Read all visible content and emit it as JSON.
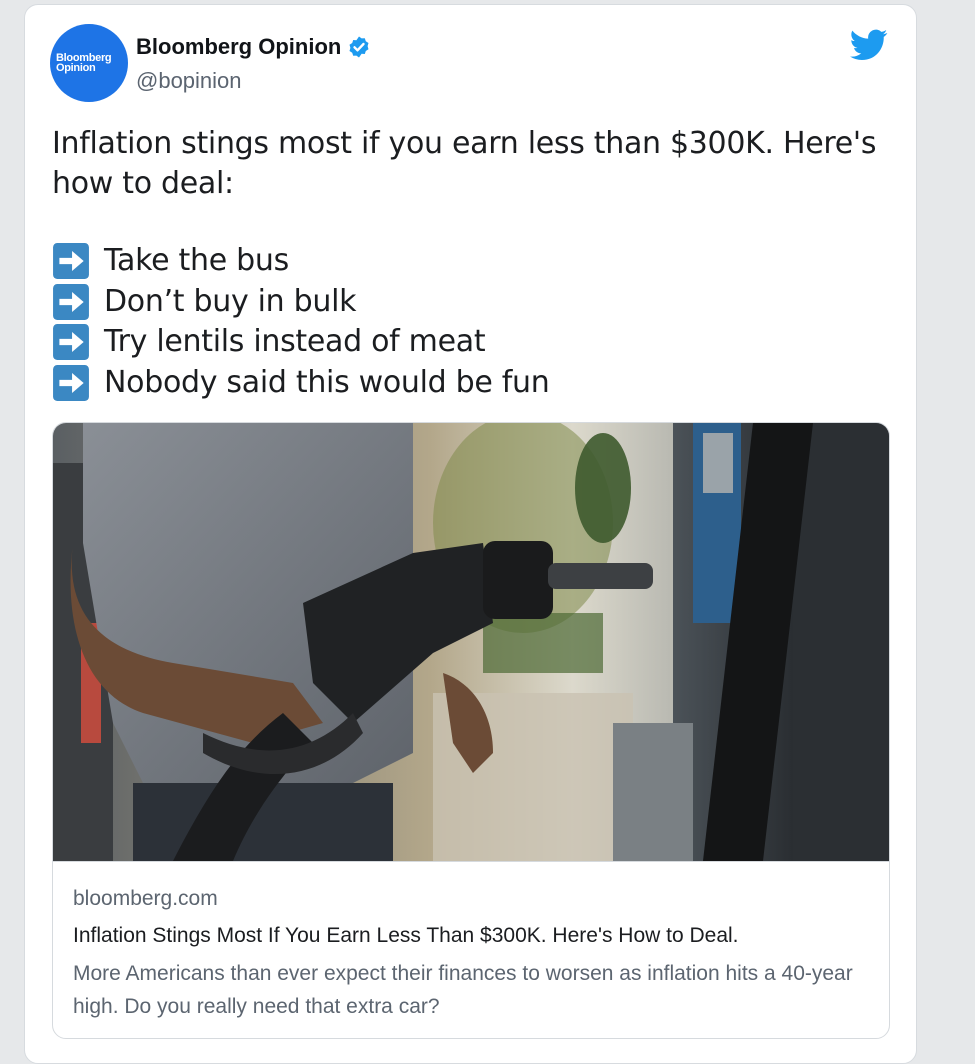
{
  "tweet": {
    "author": {
      "avatar_text_line1": "Bloomberg",
      "avatar_text_line2": "Opinion",
      "display_name": "Bloomberg Opinion",
      "handle": "@bopinion",
      "verified": true,
      "avatar_color": "#1e74e6"
    },
    "text_lines": [
      "Inflation stings most if you earn less than $300K. Here's",
      "how to deal:"
    ],
    "bullets": [
      {
        "icon": "right-arrow-emoji-icon",
        "text": "Take the bus"
      },
      {
        "icon": "right-arrow-emoji-icon",
        "text": "Don’t buy in bulk"
      },
      {
        "icon": "right-arrow-emoji-icon",
        "text": "Try lentils instead of meat"
      },
      {
        "icon": "right-arrow-emoji-icon",
        "text": "Nobody said this would be fun"
      }
    ],
    "link_card": {
      "image": "photo-gas-pump-nozzle",
      "domain": "bloomberg.com",
      "title": "Inflation Stings Most If You Earn Less Than $300K. Here's How to Deal.",
      "description": "More Americans than ever expect their finances to worsen as inflation hits a 40-year high. Do you really need that extra car?"
    }
  },
  "icons": {
    "verified": "verified-badge-icon",
    "platform": "twitter-bird-icon"
  },
  "colors": {
    "accent": "#1d9bf0",
    "text_primary": "#1b1d20",
    "text_secondary": "#5c6570"
  }
}
